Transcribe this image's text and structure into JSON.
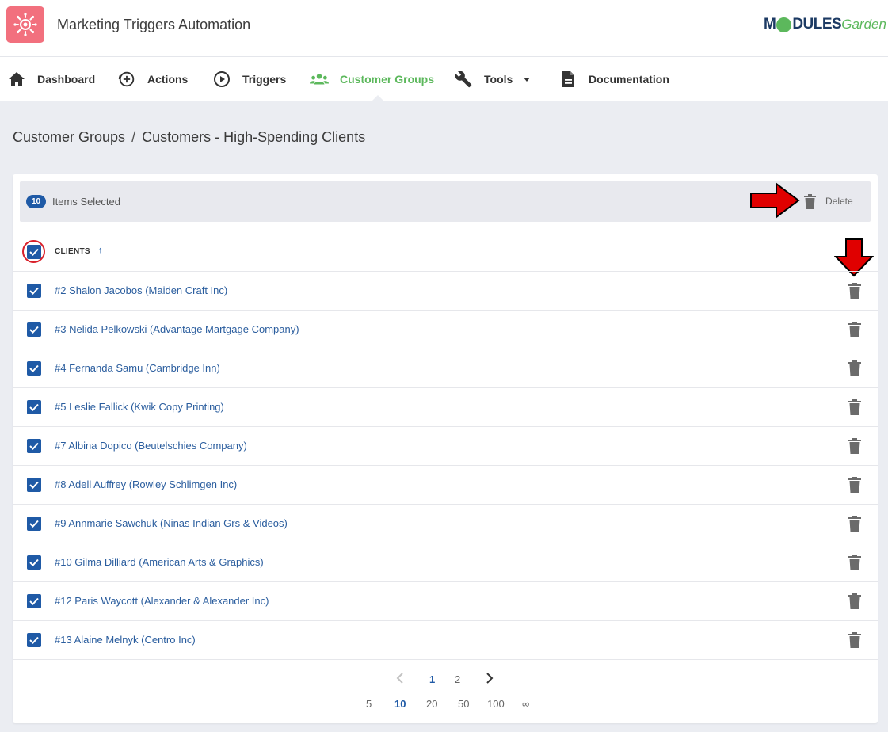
{
  "header": {
    "app_title": "Marketing Triggers Automation",
    "brand": {
      "part1": "M",
      "part2": "DULES",
      "part3": "Garden"
    }
  },
  "nav": {
    "items": [
      {
        "label": "Dashboard",
        "icon": "home-icon"
      },
      {
        "label": "Actions",
        "icon": "plus-circle-icon"
      },
      {
        "label": "Triggers",
        "icon": "play-circle-icon"
      },
      {
        "label": "Customer Groups",
        "icon": "users-icon",
        "active": true
      },
      {
        "label": "Tools",
        "icon": "wrench-icon",
        "dropdown": true
      },
      {
        "label": "Documentation",
        "icon": "document-icon"
      }
    ]
  },
  "breadcrumb": {
    "parent": "Customer Groups",
    "separator": "/",
    "current": "Customers - High-Spending Clients"
  },
  "bulk": {
    "count": "10",
    "label": "Items Selected",
    "delete_label": "Delete"
  },
  "table": {
    "column_header": "CLIENTS",
    "sort_indicator": "↑",
    "rows": [
      "#2 Shalon Jacobos (Maiden Craft Inc)",
      "#3 Nelida Pelkowski (Advantage Martgage Company)",
      "#4 Fernanda Samu (Cambridge Inn)",
      "#5 Leslie Fallick (Kwik Copy Printing)",
      "#7 Albina Dopico (Beutelschies Company)",
      "#8 Adell Auffrey (Rowley Schlimgen Inc)",
      "#9 Annmarie Sawchuk (Ninas Indian Grs & Videos)",
      "#10 Gilma Dilliard (American Arts & Graphics)",
      "#12 Paris Waycott (Alexander & Alexander Inc)",
      "#13 Alaine Melnyk (Centro Inc)"
    ]
  },
  "pagination": {
    "pages": [
      "1",
      "2"
    ],
    "current_page": "1",
    "page_sizes": [
      "5",
      "10",
      "20",
      "50",
      "100",
      "∞"
    ],
    "current_size": "10"
  },
  "colors": {
    "accent": "#1f5aa6",
    "active_nav": "#5cb85c",
    "app_icon_bg": "#f2707e",
    "annotation_red": "#e00000"
  }
}
